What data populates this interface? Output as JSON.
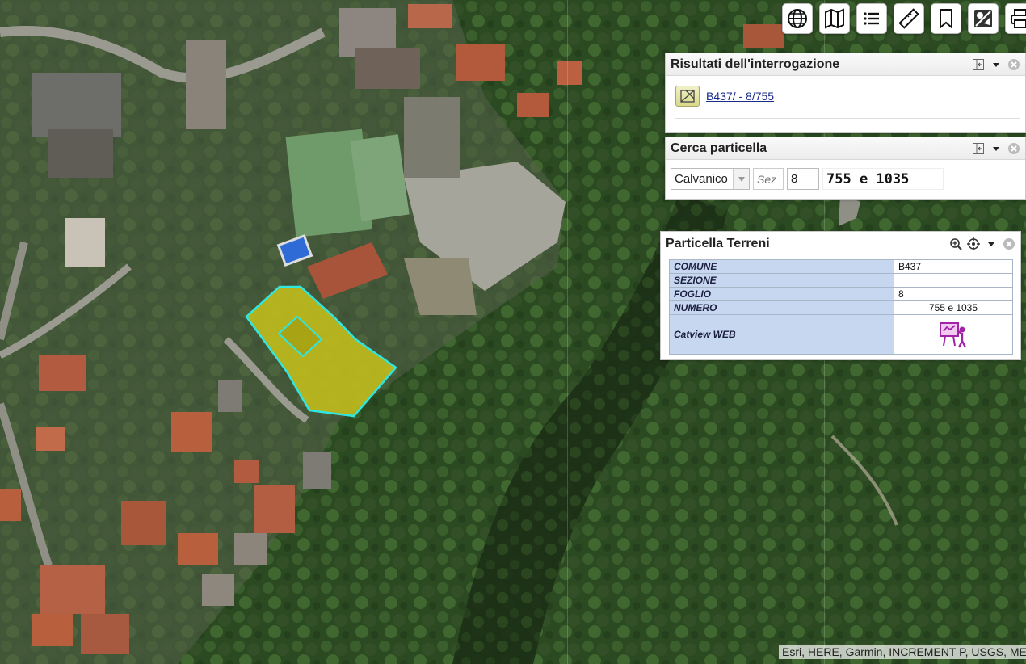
{
  "toolbar": {
    "icons": [
      "globe-icon",
      "map-icon",
      "list-icon",
      "ruler-icon",
      "bookmark-icon",
      "layers-icon",
      "print-icon"
    ]
  },
  "results_panel": {
    "title": "Risultati dell'interrogazione",
    "result_link": "B437/ - 8/755"
  },
  "cerca_panel": {
    "title": "Cerca particella",
    "comune_value": "Calvanico",
    "sezione_placeholder": "Sez",
    "foglio_value": "8",
    "numero_value": "755 e 1035"
  },
  "terreni_panel": {
    "title": "Particella Terreni",
    "rows": [
      {
        "key": "COMUNE",
        "value": "B437"
      },
      {
        "key": "SEZIONE",
        "value": ""
      },
      {
        "key": "FOGLIO",
        "value": "8"
      },
      {
        "key": "NUMERO",
        "value": "755 e 1035"
      },
      {
        "key": "Catview WEB",
        "value": ""
      }
    ]
  },
  "map": {
    "attribution": "Esri, HERE, Garmin, INCREMENT P, USGS, METI/NASA",
    "parcel_fill_color": "#c8c21a",
    "parcel_outline_color": "#2fe6e0"
  }
}
